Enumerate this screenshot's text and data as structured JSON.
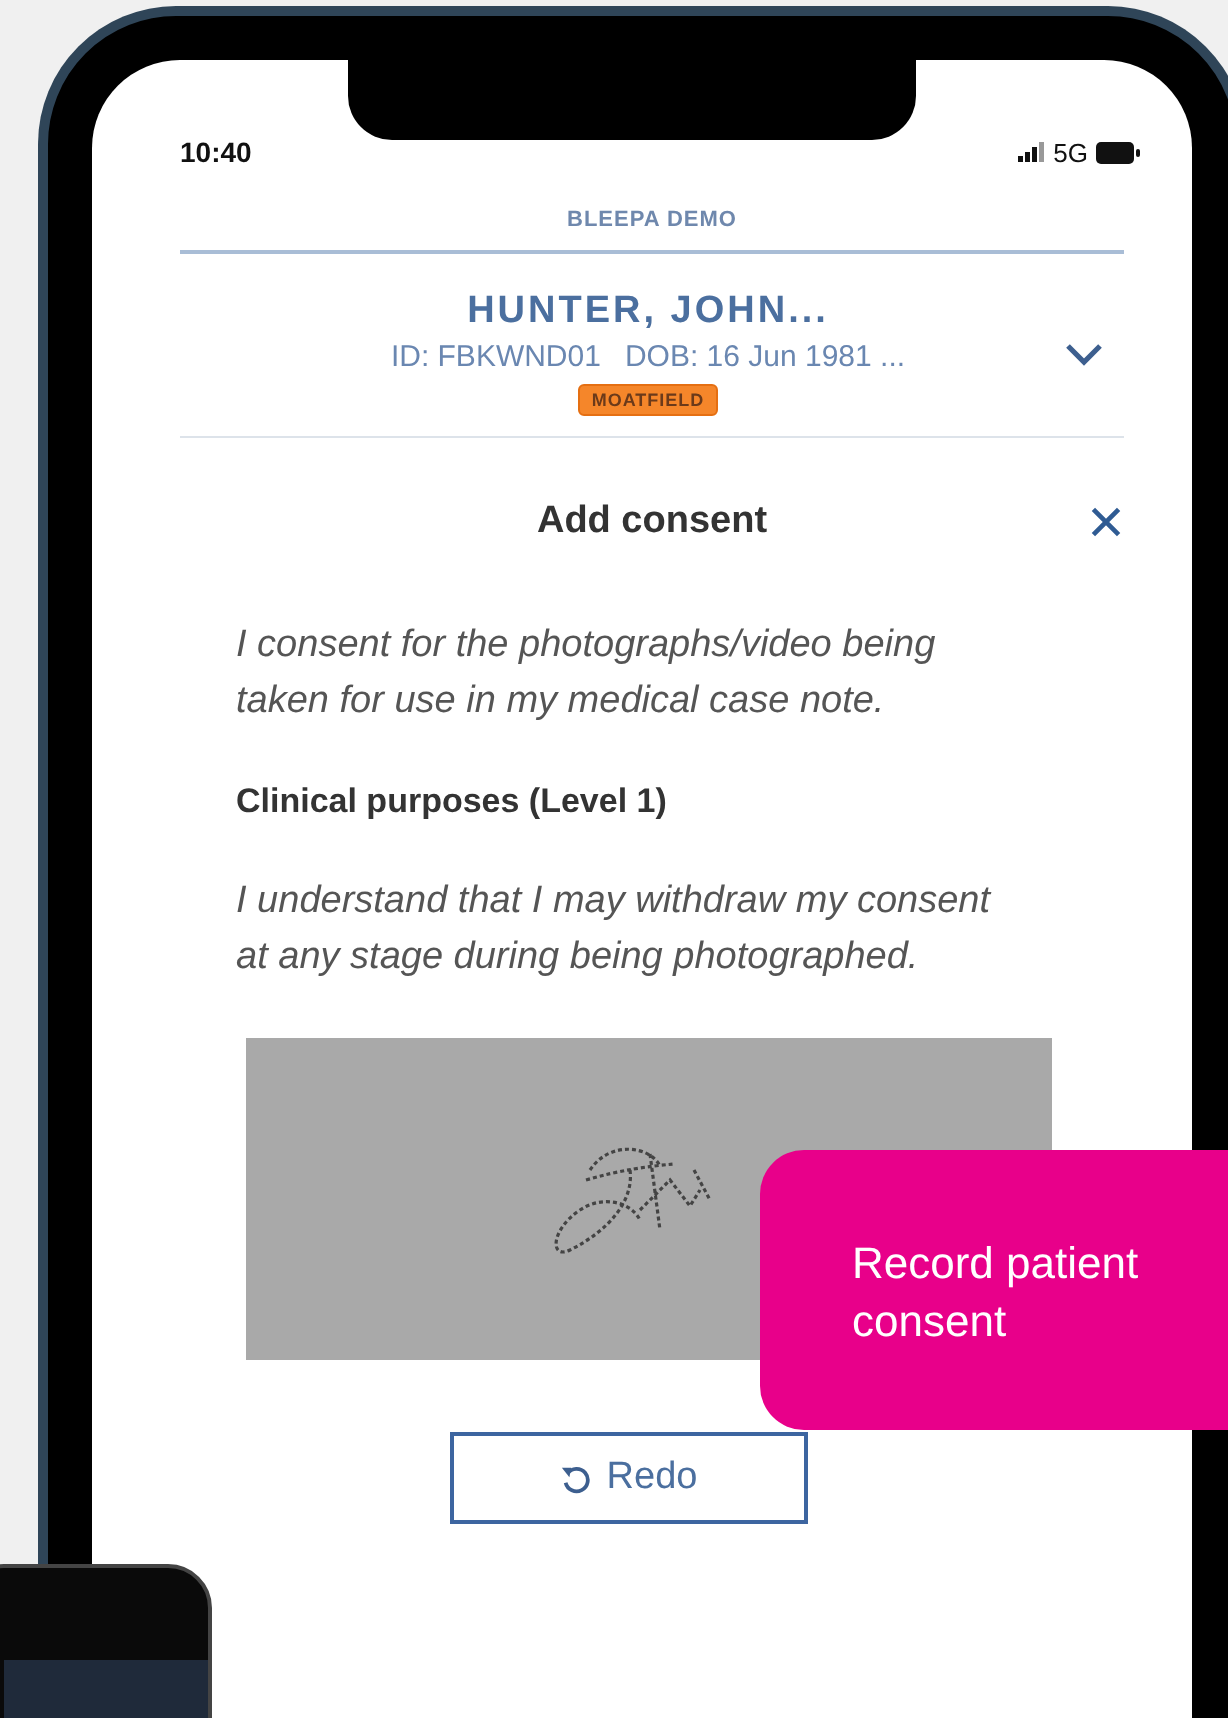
{
  "status_bar": {
    "time": "10:40",
    "network": "5G"
  },
  "app": {
    "org": "BLEEPA DEMO"
  },
  "patient": {
    "name": "HUNTER, JOHN...",
    "id": "ID: FBKWND01",
    "dob": "DOB: 16 Jun 1981 ...",
    "location": "MOATFIELD"
  },
  "dialog": {
    "title": "Add consent",
    "blocks": [
      {
        "kind": "statement",
        "text": "I consent for the photographs/video being taken for use in my medical case note."
      },
      {
        "kind": "heading",
        "text": "Clinical purposes (Level 1)"
      },
      {
        "kind": "statement",
        "text": "I understand that I may withdraw my consent at any stage during being photographed."
      }
    ],
    "redo_button": "Redo"
  },
  "callout": {
    "text": "Record patient consent"
  }
}
